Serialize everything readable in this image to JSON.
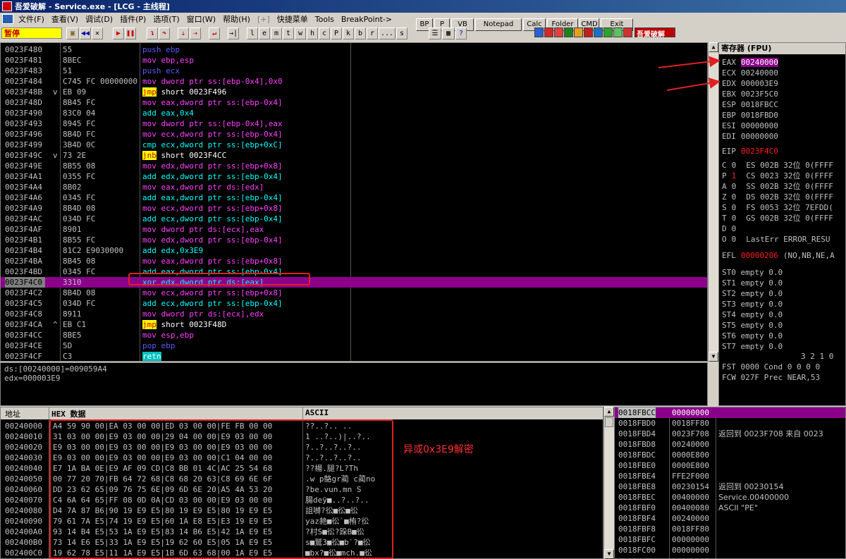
{
  "window": {
    "title": "吾爱破解 - Service.exe - [LCG - 主线程]",
    "logo": "吾爱破解"
  },
  "menu": [
    "文件(F)",
    "查看(V)",
    "调试(D)",
    "插件(P)",
    "选项(T)",
    "窗口(W)",
    "帮助(H)",
    "[+]",
    "快捷菜单",
    "Tools",
    "BreakPoint->"
  ],
  "plugin_buttons": [
    "BP",
    "P",
    "VB",
    "Notepad",
    "Calc",
    "Folder",
    "CMD",
    "Exit"
  ],
  "status_text": "暂停",
  "toolbar_letters": [
    "l",
    "e",
    "m",
    "t",
    "w",
    "h",
    "c",
    "P",
    "k",
    "b",
    "r",
    "...",
    "s"
  ],
  "cpu_rows": [
    {
      "addr": "0023F480",
      "hex": "55",
      "mark": "",
      "asm": "push ebp"
    },
    {
      "addr": "0023F481",
      "hex": "8BEC",
      "mark": "",
      "asm": "mov ebp,esp"
    },
    {
      "addr": "0023F483",
      "hex": "51",
      "mark": "",
      "asm": "push ecx"
    },
    {
      "addr": "0023F484",
      "hex": "C745 FC 00000000",
      "mark": "",
      "asm": "mov dword ptr ss:[ebp-0x4],0x0"
    },
    {
      "addr": "0023F48B",
      "hex": "EB 09",
      "mark": "v",
      "asm": "jmp short 0023F496"
    },
    {
      "addr": "0023F48D",
      "hex": "8B45 FC",
      "mark": "",
      "asm": "mov eax,dword ptr ss:[ebp-0x4]"
    },
    {
      "addr": "0023F490",
      "hex": "83C0 04",
      "mark": "",
      "asm": "add eax,0x4"
    },
    {
      "addr": "0023F493",
      "hex": "8945 FC",
      "mark": "",
      "asm": "mov dword ptr ss:[ebp-0x4],eax"
    },
    {
      "addr": "0023F496",
      "hex": "8B4D FC",
      "mark": "",
      "asm": "mov ecx,dword ptr ss:[ebp-0x4]"
    },
    {
      "addr": "0023F499",
      "hex": "3B4D 0C",
      "mark": "",
      "asm": "cmp ecx,dword ptr ss:[ebp+0xC]"
    },
    {
      "addr": "0023F49C",
      "hex": "73 2E",
      "mark": "v",
      "asm": "jnb short 0023F4CC"
    },
    {
      "addr": "0023F49E",
      "hex": "8B55 08",
      "mark": "",
      "asm": "mov edx,dword ptr ss:[ebp+0x8]"
    },
    {
      "addr": "0023F4A1",
      "hex": "0355 FC",
      "mark": "",
      "asm": "add edx,dword ptr ss:[ebp-0x4]"
    },
    {
      "addr": "0023F4A4",
      "hex": "8B02",
      "mark": "",
      "asm": "mov eax,dword ptr ds:[edx]"
    },
    {
      "addr": "0023F4A6",
      "hex": "0345 FC",
      "mark": "",
      "asm": "add eax,dword ptr ss:[ebp-0x4]"
    },
    {
      "addr": "0023F4A9",
      "hex": "8B4D 08",
      "mark": "",
      "asm": "mov ecx,dword ptr ss:[ebp+0x8]"
    },
    {
      "addr": "0023F4AC",
      "hex": "034D FC",
      "mark": "",
      "asm": "add ecx,dword ptr ss:[ebp-0x4]"
    },
    {
      "addr": "0023F4AF",
      "hex": "8901",
      "mark": "",
      "asm": "mov dword ptr ds:[ecx],eax"
    },
    {
      "addr": "0023F4B1",
      "hex": "8B55 FC",
      "mark": "",
      "asm": "mov edx,dword ptr ss:[ebp-0x4]"
    },
    {
      "addr": "0023F4B4",
      "hex": "81C2 E9030000",
      "mark": "",
      "asm": "add edx,0x3E9"
    },
    {
      "addr": "0023F4BA",
      "hex": "8B45 08",
      "mark": "",
      "asm": "mov eax,dword ptr ss:[ebp+0x8]"
    },
    {
      "addr": "0023F4BD",
      "hex": "0345 FC",
      "mark": "",
      "asm": "add eax,dword ptr ss:[ebp-0x4]"
    },
    {
      "addr": "0023F4C0",
      "hex": "3310",
      "mark": "",
      "asm": "xor edx,dword ptr ds:[eax]",
      "selected": true
    },
    {
      "addr": "0023F4C2",
      "hex": "8B4D 08",
      "mark": "",
      "asm": "mov ecx,dword ptr ss:[ebp+0x8]"
    },
    {
      "addr": "0023F4C5",
      "hex": "034D FC",
      "mark": "",
      "asm": "add ecx,dword ptr ss:[ebp-0x4]"
    },
    {
      "addr": "0023F4C8",
      "hex": "8911",
      "mark": "",
      "asm": "mov dword ptr ds:[ecx],edx"
    },
    {
      "addr": "0023F4CA",
      "hex": "EB C1",
      "mark": "^",
      "asm": "jmp short 0023F48D"
    },
    {
      "addr": "0023F4CC",
      "hex": "8BE5",
      "mark": "",
      "asm": "mov esp,ebp"
    },
    {
      "addr": "0023F4CE",
      "hex": "5D",
      "mark": "",
      "asm": "pop ebp"
    },
    {
      "addr": "0023F4CF",
      "hex": "C3",
      "mark": "",
      "asm": "retn"
    }
  ],
  "info_lines": [
    "ds:[00240000]=009059A4",
    "edx=000003E9"
  ],
  "registers": {
    "title": "寄存器 (FPU)",
    "gpr": [
      {
        "name": "EAX",
        "value": "00240000",
        "highlight": true
      },
      {
        "name": "ECX",
        "value": "00240000"
      },
      {
        "name": "EDX",
        "value": "000003E9"
      },
      {
        "name": "EBX",
        "value": "0023F5C0"
      },
      {
        "name": "ESP",
        "value": "0018FBCC"
      },
      {
        "name": "EBP",
        "value": "0018FBD0"
      },
      {
        "name": "ESI",
        "value": "00000000"
      },
      {
        "name": "EDI",
        "value": "00000000"
      }
    ],
    "eip": {
      "name": "EIP",
      "value": "0023F4C0"
    },
    "flags": [
      {
        "f": "C",
        "v": "0",
        "seg": "ES 002B 32位 0(FFFF"
      },
      {
        "f": "P",
        "v": "1",
        "seg": "CS 0023 32位 0(FFFF"
      },
      {
        "f": "A",
        "v": "0",
        "seg": "SS 002B 32位 0(FFFF"
      },
      {
        "f": "Z",
        "v": "0",
        "seg": "DS 002B 32位 0(FFFF"
      },
      {
        "f": "S",
        "v": "0",
        "seg": "FS 0053 32位 7EFDD("
      },
      {
        "f": "T",
        "v": "0",
        "seg": "GS 002B 32位 0(FFFF"
      },
      {
        "f": "D",
        "v": "0",
        "seg": ""
      },
      {
        "f": "O",
        "v": "0",
        "seg": "LastErr ERROR_RESU"
      }
    ],
    "efl": {
      "name": "EFL",
      "value": "00000206",
      "desc": "(NO,NB,NE,A"
    },
    "fpu": [
      "ST0 empty 0.0",
      "ST1 empty 0.0",
      "ST2 empty 0.0",
      "ST3 empty 0.0",
      "ST4 empty 0.0",
      "ST5 empty 0.0",
      "ST6 empty 0.0",
      "ST7 empty 0.0"
    ],
    "fpu_bits_header": "3 2 1 0",
    "fst": "FST 0000  Cond 0 0 0 0",
    "fcw": "FCW 027F  Prec NEAR,53"
  },
  "dump": {
    "headers": {
      "addr": "地址",
      "hex": "HEX 数据",
      "ascii": "ASCII"
    },
    "rows": [
      {
        "addr": "00240000",
        "hex": "A4 59 90 00|EA 03 00 00|ED 03 00 00|FE FB 00 00",
        "ascii": "  ??..?..  .."
      },
      {
        "addr": "00240010",
        "hex": "31 03 00 00|E9 03 00 00|29 04 00 00|E9 03 00 00",
        "ascii": "1 ..?..)|..?.."
      },
      {
        "addr": "00240020",
        "hex": "E9 03 00 00|E9 03 00 00|E9 03 00 00|E9 03 00 00",
        "ascii": "?..?..?..?.."
      },
      {
        "addr": "00240030",
        "hex": "E9 03 00 00|E9 03 00 00|E9 03 00 00|C1 04 00 00",
        "ascii": "?..?..?..?.."
      },
      {
        "addr": "00240040",
        "hex": "E7 1A BA 0E|E9 AF 09 CD|C8 BB 01 4C|AC 25 54 68",
        "ascii": "??楊.腿?L?Th"
      },
      {
        "addr": "00240050",
        "hex": "00 77 20 70|FB 64 72 68|C8 68 20 63|C8 69 6E 6F",
        "ascii": ".w p鴼gr蔺 c蔺no"
      },
      {
        "addr": "00240060",
        "hex": "DD 23 62 65|09 76 75 6E|09 6D 6E 20|A5 4A 53 20",
        "ascii": "?be.vun.mn   S"
      },
      {
        "addr": "00240070",
        "hex": "C4 6A 64 65|FF 08 0D 0A|CD 03 00 00|E9 03 00 00",
        "ascii": "腸deÿ■..?..?.."
      },
      {
        "addr": "00240080",
        "hex": "D4 7A 87 B6|90 19 E9 E5|80 19 E9 E5|80 19 E9 E5",
        "ascii": "詛嚩?彸■彸■彸"
      },
      {
        "addr": "00240090",
        "hex": "79 61 7A E5|74 19 E9 E5|60 1A E8 E5|E3 19 E9 E5",
        "ascii": "yaz赩■彸`■栯?彸"
      },
      {
        "addr": "002400A0",
        "hex": "93 14 B4 E5|53 1A E9 E5|83 14 B6 E5|42 1A E9 E5",
        "ascii": "?村S■彸?跺B■彸"
      },
      {
        "addr": "002400B0",
        "hex": "73 14 E6 E5|33 1A E9 E5|19 62 60 E5|05 1A E9 E5",
        "ascii": "s■鷲3■彸■b`?■彸"
      },
      {
        "addr": "002400C0",
        "hex": "19 62 78 E5|11 1A E9 E5|1B 6D 63 68|00 1A E9 E5",
        "ascii": "■bx?■彸■mch.■彸"
      }
    ]
  },
  "stack_rows": [
    {
      "addr": "0018FBCC",
      "val": "00000000",
      "comment": "",
      "selected": true
    },
    {
      "addr": "0018FBD0",
      "val": "0018FF80",
      "comment": ""
    },
    {
      "addr": "0018FBD4",
      "val": "0023F708",
      "comment": "返回到 0023F708 来自 0023"
    },
    {
      "addr": "0018FBD8",
      "val": "00240000",
      "comment": ""
    },
    {
      "addr": "0018FBDC",
      "val": "0000E800",
      "comment": ""
    },
    {
      "addr": "0018FBE0",
      "val": "0000E800",
      "comment": ""
    },
    {
      "addr": "0018FBE4",
      "val": "FFE2F000",
      "comment": ""
    },
    {
      "addr": "0018FBE8",
      "val": "00230154",
      "comment": "返回到 00230154"
    },
    {
      "addr": "0018FBEC",
      "val": "00400000",
      "comment": "Service.00400000"
    },
    {
      "addr": "0018FBF0",
      "val": "00400080",
      "comment": "ASCII \"PE\""
    },
    {
      "addr": "0018FBF4",
      "val": "00240000",
      "comment": ""
    },
    {
      "addr": "0018FBF8",
      "val": "0018FF80",
      "comment": ""
    },
    {
      "addr": "0018FBFC",
      "val": "00000000",
      "comment": ""
    },
    {
      "addr": "0018FC00",
      "val": "00000000",
      "comment": ""
    }
  ],
  "annotation": "异或0x3E9解密",
  "colors": {
    "selection": "#8b008b",
    "annotation": "#ff3030",
    "jump_bg": "#ffff00",
    "flag_changed": "#ff2020"
  }
}
